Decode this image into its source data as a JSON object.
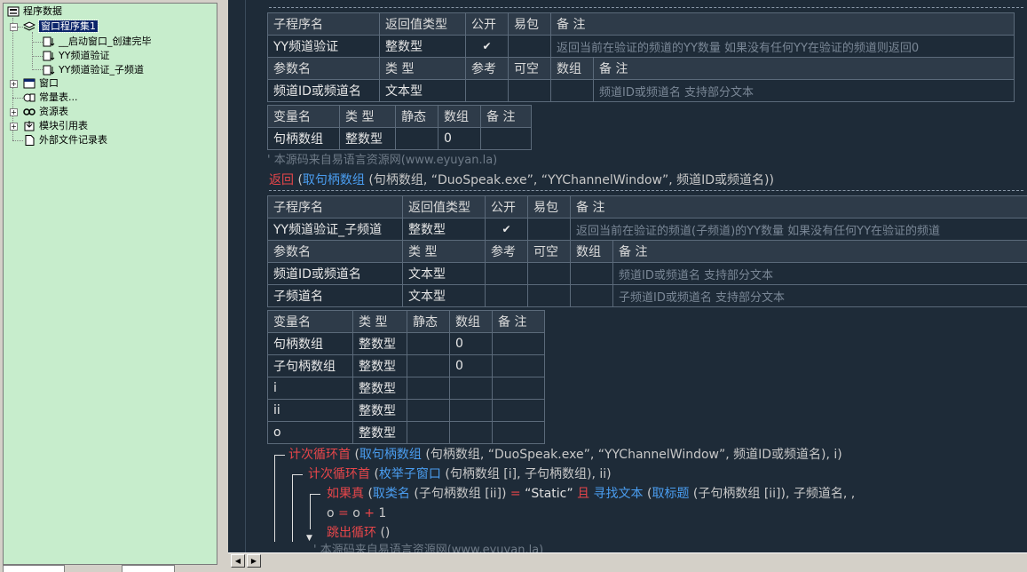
{
  "tree": {
    "root": "程序数据",
    "program_set": "窗口程序集1",
    "subs": [
      "__启动窗口_创建完毕",
      "YY频道验证",
      "YY频道验证_子频道"
    ],
    "others": [
      "窗口",
      "常量表...",
      "资源表",
      "模块引用表",
      "外部文件记录表"
    ]
  },
  "table_labels": {
    "sub_name": "子程序名",
    "return_type": "返回值类型",
    "public": "公开",
    "easy_pack": "易包",
    "note": "备 注",
    "param_name": "参数名",
    "type": "类 型",
    "ref": "参考",
    "optional": "可空",
    "array": "数组",
    "var_name": "变量名",
    "static": "静态",
    "check": "✔"
  },
  "sub1": {
    "name": "YY频道验证",
    "return_type": "整数型",
    "note": "返回当前在验证的频道的YY数量 如果没有任何YY在验证的频道则返回0",
    "params": [
      {
        "name": "频道ID或频道名",
        "type": "文本型",
        "note": "频道ID或频道名 支持部分文本"
      }
    ],
    "vars": [
      {
        "name": "句柄数组",
        "type": "整数型",
        "array": "0"
      }
    ]
  },
  "code1": {
    "comment": "' 本源码来自易语言资源网(www.eyuyan.la)",
    "return_kw": "返回",
    "return_open": " (",
    "fn": "取句柄数组",
    "rest": " (句柄数组, “DuoSpeak.exe”, “YYChannelWindow”, 频道ID或频道名))"
  },
  "sub2": {
    "name": "YY频道验证_子频道",
    "return_type": "整数型",
    "note": "返回当前在验证的频道(子频道)的YY数量 如果没有任何YY在验证的频道",
    "params": [
      {
        "name": "频道ID或频道名",
        "type": "文本型",
        "note": "频道ID或频道名 支持部分文本"
      },
      {
        "name": "子频道名",
        "type": "文本型",
        "note": "子频道ID或频道名 支持部分文本"
      }
    ],
    "vars": [
      {
        "name": "句柄数组",
        "type": "整数型",
        "array": "0"
      },
      {
        "name": "子句柄数组",
        "type": "整数型",
        "array": "0"
      },
      {
        "name": "i",
        "type": "整数型",
        "array": ""
      },
      {
        "name": "ii",
        "type": "整数型",
        "array": ""
      },
      {
        "name": "o",
        "type": "整数型",
        "array": ""
      }
    ]
  },
  "code2": {
    "l1_kw": "计次循环首",
    "l1_open": " (",
    "l1_fn": "取句柄数组",
    "l1_rest": " (句柄数组, “DuoSpeak.exe”, “YYChannelWindow”, 频道ID或频道名), i)",
    "l2_kw": "计次循环首",
    "l2_open": " (",
    "l2_fn": "枚举子窗口",
    "l2_rest": " (句柄数组 [i], 子句柄数组), ii)",
    "l3_kw": "如果真",
    "l3_open": " (",
    "l3_fn": "取类名",
    "l3_mid": " (子句柄数组 [ii]) ",
    "l3_eq": "=",
    "l3_str": " “Static” ",
    "l3_and": "且",
    "l3_fn2": " 寻找文本",
    "l3_open2": " (",
    "l3_fn3": "取标题",
    "l3_rest": " (子句柄数组 [ii]), 子频道名, ,",
    "l4_a": "o ",
    "l4_eq": "=",
    "l4_b": " o ",
    "l4_plus": "+",
    "l4_c": " 1",
    "l5_kw": "跳出循环",
    "l5_rest": " ()",
    "l6_comment": "' 本源码来自易语言资源网(www.eyuyan.la)"
  }
}
